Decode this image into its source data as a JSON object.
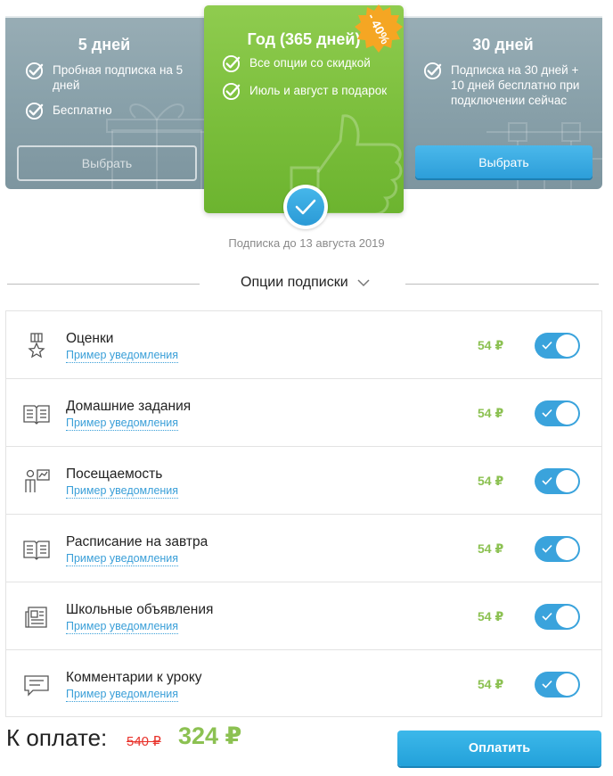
{
  "plans": [
    {
      "title": "5 дней",
      "features": [
        "Пробная подписка на 5 дней",
        "Бесплатно"
      ],
      "button": "Выбрать",
      "button_style": "outline"
    },
    {
      "title": "Год (365 дней)",
      "features": [
        "Все опции со скидкой",
        "Июль и август в подарок"
      ],
      "badge": "- 40%",
      "selected": true
    },
    {
      "title": "30 дней",
      "features": [
        "Подписка на 30 дней + 10 дней бесплатно при подключении сейчас"
      ],
      "button": "Выбрать",
      "button_style": "primary"
    }
  ],
  "subscription_until": "Подписка до 13 августа 2019",
  "options_header": "Опции подписки",
  "options": [
    {
      "name": "Оценки",
      "link": "Пример уведомления",
      "price": "54 ₽",
      "icon": "medal-icon",
      "enabled": true
    },
    {
      "name": "Домашние задания",
      "link": "Пример уведомления",
      "price": "54 ₽",
      "icon": "homework-book-icon",
      "enabled": true
    },
    {
      "name": "Посещаемость",
      "link": "Пример уведомления",
      "price": "54 ₽",
      "icon": "teacher-board-icon",
      "enabled": true
    },
    {
      "name": "Расписание на завтра",
      "link": "Пример уведомления",
      "price": "54 ₽",
      "icon": "open-book-icon",
      "enabled": true
    },
    {
      "name": "Школьные объявления",
      "link": "Пример уведомления",
      "price": "54 ₽",
      "icon": "newspaper-icon",
      "enabled": true
    },
    {
      "name": "Комментарии к уроку",
      "link": "Пример уведомления",
      "price": "54 ₽",
      "icon": "comment-icon",
      "enabled": true
    }
  ],
  "payment": {
    "label": "К оплате:",
    "old_price": "540 ₽",
    "new_price": "324 ₽",
    "button": "Оплатить"
  },
  "colors": {
    "green": "#8cc152",
    "blue": "#2d9ed9",
    "red": "#e8332c",
    "slate": "#8aa2ab"
  }
}
